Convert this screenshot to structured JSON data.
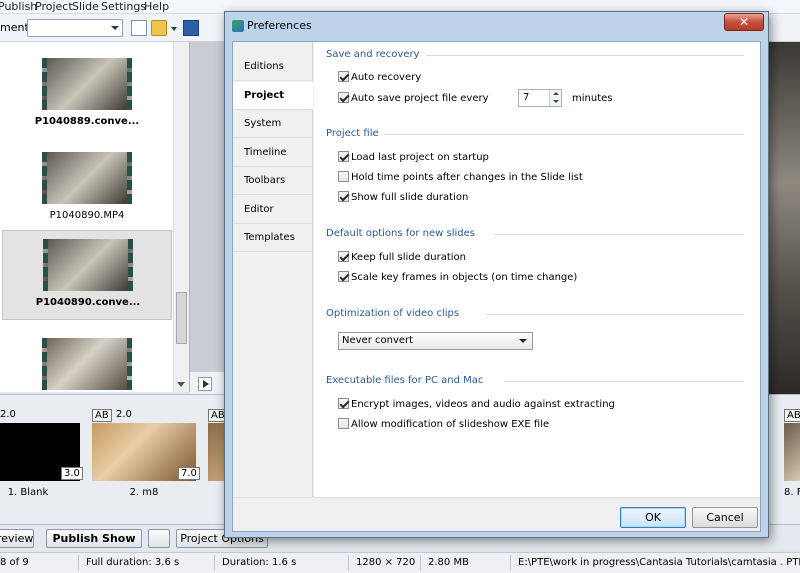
{
  "menu": [
    "Publish",
    "Project",
    "Slide",
    "Settings",
    "Help"
  ],
  "toolbar": {
    "left_label": "ment"
  },
  "files": [
    {
      "name": "P1040889.conve...",
      "bold": true
    },
    {
      "name": "P1040890.MP4",
      "bold": false
    },
    {
      "name": "P1040890.conve...",
      "bold": true
    }
  ],
  "slides": [
    {
      "duration": "2.0",
      "tag": "3.0",
      "name": "1. Blank"
    },
    {
      "ab": "AB",
      "duration": "2.0",
      "tag": "7.0",
      "name": "2. m8"
    },
    {
      "ab": "AB"
    },
    {
      "ab": "AB",
      "name": "8. F"
    }
  ],
  "bottom_buttons": {
    "preview": "review",
    "publish": "Publish Show",
    "project_options": "Project Options"
  },
  "status": {
    "count": "8 of 9",
    "full_duration": "Full duration: 3.6 s",
    "duration": "Duration: 1.6 s",
    "resolution": "1280 × 720",
    "size": "2.80 MB",
    "path": "E:\\PTE\\work in progress\\Cantasia Tutorials\\camtasia . PTE T"
  },
  "dialog": {
    "title": "Preferences",
    "close": "✕",
    "nav": [
      "Editions",
      "Project",
      "System",
      "Timeline",
      "Toolbars",
      "Editor",
      "Templates"
    ],
    "active_nav": 1,
    "sections": {
      "save_recovery": "Save and recovery",
      "project_file": "Project file",
      "defaults": "Default options for new slides",
      "optimization": "Optimization of video clips",
      "executable": "Executable files for PC and Mac"
    },
    "options": {
      "auto_recovery": {
        "label": "Auto recovery",
        "checked": true
      },
      "auto_save": {
        "label": "Auto save project file every",
        "checked": true,
        "value": "7",
        "unit": "minutes"
      },
      "load_last": {
        "label": "Load last project on startup",
        "checked": true
      },
      "hold_time": {
        "label": "Hold time points after changes in the Slide list",
        "checked": false
      },
      "show_full": {
        "label": "Show full slide duration",
        "checked": true
      },
      "keep_full": {
        "label": "Keep full slide duration",
        "checked": true
      },
      "scale_key": {
        "label": "Scale key frames in objects (on time change)",
        "checked": true
      },
      "encrypt": {
        "label": "Encrypt images, videos and audio against extracting",
        "checked": true
      },
      "allow_mod": {
        "label": "Allow modification of slideshow EXE file",
        "checked": false
      }
    },
    "video_option": "Never convert",
    "ok": "OK",
    "cancel": "Cancel"
  }
}
